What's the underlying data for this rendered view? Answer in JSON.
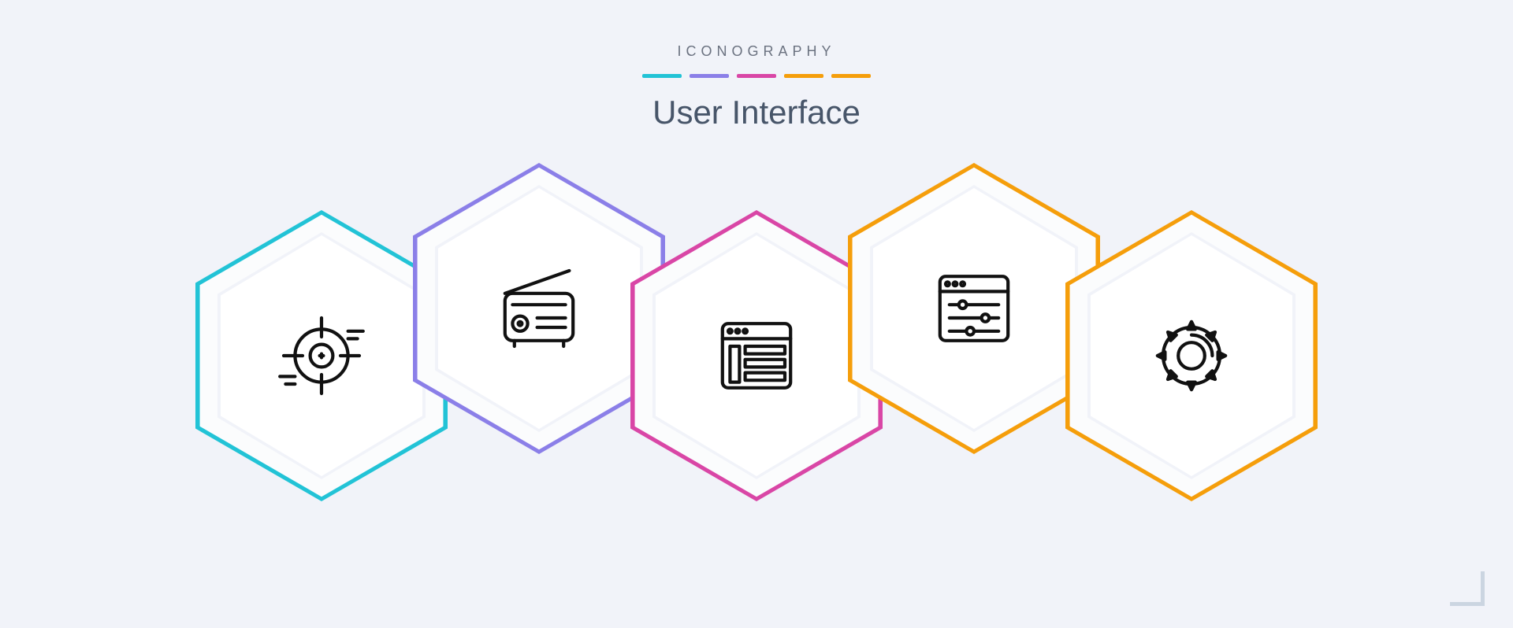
{
  "header": {
    "brand": "ICONOGRAPHY",
    "title": "User Interface",
    "accent_colors": [
      "#22c3d6",
      "#8b7fe8",
      "#d946a6",
      "#f59e0b",
      "#f59e0b"
    ]
  },
  "hexes": [
    {
      "color": "#22c3d6",
      "icon": "target-icon"
    },
    {
      "color": "#8b7fe8",
      "icon": "radio-icon"
    },
    {
      "color": "#d946a6",
      "icon": "browser-list-icon"
    },
    {
      "color": "#f59e0b",
      "icon": "browser-sliders-icon"
    },
    {
      "color": "#f59e0b",
      "icon": "gear-icon"
    }
  ]
}
